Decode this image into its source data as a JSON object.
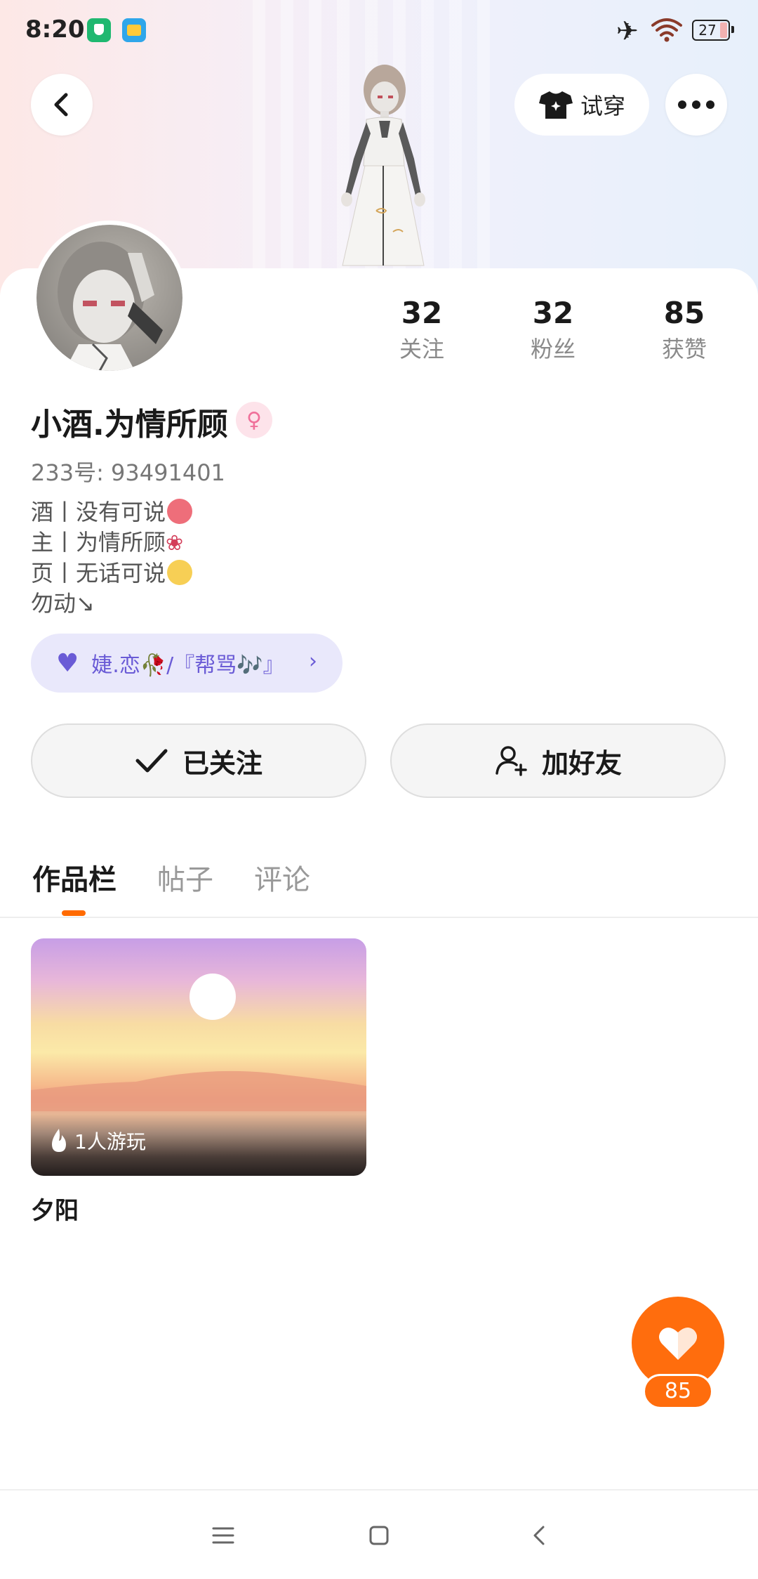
{
  "status_bar": {
    "time": "8:20",
    "battery": "27",
    "icons": [
      "app-shield-icon",
      "app-wallet-icon",
      "airplane-icon",
      "wifi-icon",
      "battery-icon"
    ]
  },
  "header": {
    "back_icon": "chevron-left-icon",
    "tryon_label": "试穿",
    "tryon_icon": "tshirt-icon",
    "more_icon": "more-dots-icon"
  },
  "profile": {
    "stats": [
      {
        "value": "32",
        "label": "关注"
      },
      {
        "value": "32",
        "label": "粉丝"
      },
      {
        "value": "85",
        "label": "获赞"
      }
    ],
    "name": "小酒.为情所顾",
    "gender_icon": "female-icon",
    "uid": "233号: 93491401",
    "bio": [
      "酒丨没有可说",
      "主丨为情所顾",
      "页丨无话可说",
      "勿动↘"
    ],
    "guild": "婕.恋🥀/『帮骂🎶』"
  },
  "actions": {
    "following_label": "已关注",
    "add_friend_label": "加好友"
  },
  "tabs": [
    {
      "label": "作品栏",
      "active": true
    },
    {
      "label": "帖子",
      "active": false
    },
    {
      "label": "评论",
      "active": false
    }
  ],
  "works": [
    {
      "title": "夕阳",
      "plays": "1人游玩"
    }
  ],
  "like": {
    "count": "85"
  },
  "colors": {
    "accent": "#ff6d0d",
    "guild": "#6a5bd6"
  }
}
